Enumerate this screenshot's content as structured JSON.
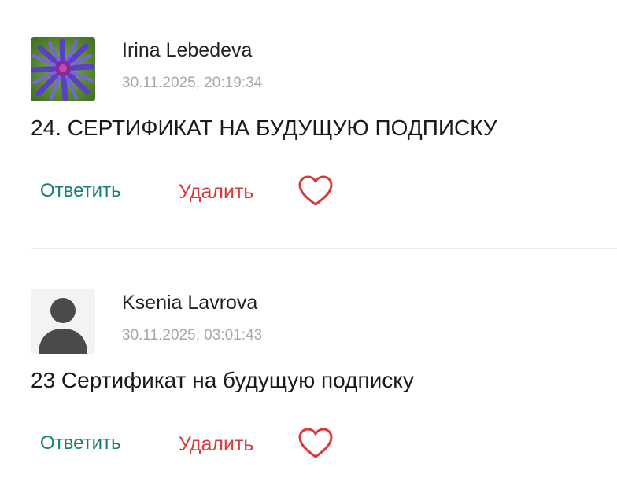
{
  "comments": [
    {
      "author": "Irina Lebedeva",
      "date": "30.11.2025, 20:19:34",
      "text": "24. СЕРТИФИКАТ НА БУДУЩУЮ ПОДПИСКУ",
      "avatar": "flower-photo-icon",
      "reply_label": "Ответить",
      "delete_label": "Удалить",
      "like_icon": "heart-outline-icon"
    },
    {
      "author": "Ksenia Lavrova",
      "date": "30.11.2025, 03:01:43",
      "text": "23 Сертификат на будущую подписку",
      "avatar": "default-user-icon",
      "reply_label": "Ответить",
      "delete_label": "Удалить",
      "like_icon": "heart-outline-icon"
    }
  ],
  "colors": {
    "reply": "#178070",
    "delete": "#d83a3a",
    "heart": "#d83a3a",
    "date": "#a7a7a7",
    "divider": "#ececec"
  }
}
